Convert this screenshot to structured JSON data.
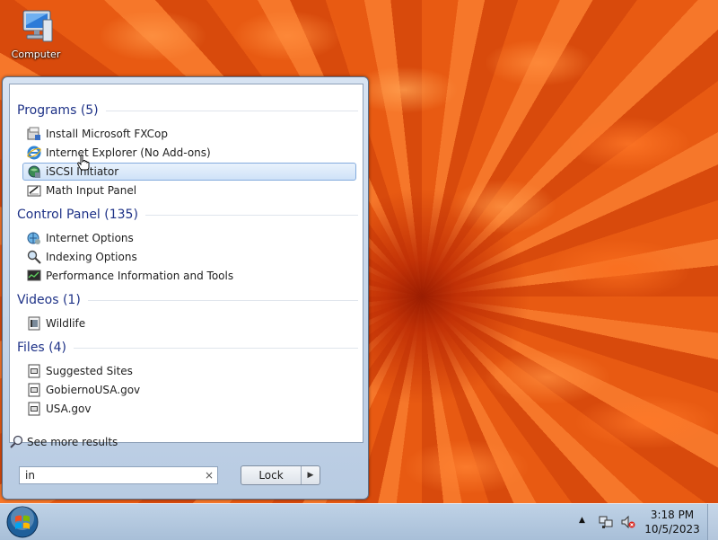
{
  "desktop": {
    "icons": [
      {
        "label": "Computer",
        "icon": "computer-icon"
      }
    ]
  },
  "start_menu": {
    "groups": [
      {
        "title": "Programs (5)",
        "items": [
          {
            "label": "Install Microsoft FXCop",
            "icon": "installer-icon"
          },
          {
            "label": "Internet Explorer (No Add-ons)",
            "icon": "ie-icon"
          },
          {
            "label": "iSCSI Initiator",
            "icon": "iscsi-icon",
            "selected": true
          },
          {
            "label": "Math Input Panel",
            "icon": "math-input-icon"
          }
        ]
      },
      {
        "title": "Control Panel (135)",
        "items": [
          {
            "label": "Internet Options",
            "icon": "internet-options-icon"
          },
          {
            "label": "Indexing Options",
            "icon": "indexing-options-icon"
          },
          {
            "label": "Performance Information and Tools",
            "icon": "performance-icon"
          }
        ]
      },
      {
        "title": "Videos (1)",
        "items": [
          {
            "label": "Wildlife",
            "icon": "video-file-icon"
          }
        ]
      },
      {
        "title": "Files (4)",
        "items": [
          {
            "label": "Suggested Sites",
            "icon": "file-icon"
          },
          {
            "label": "GobiernoUSA.gov",
            "icon": "file-icon"
          },
          {
            "label": "USA.gov",
            "icon": "file-icon"
          }
        ]
      }
    ],
    "see_more": "See more results",
    "search": {
      "value": "in",
      "clear_glyph": "×"
    },
    "power_button": {
      "label": "Lock",
      "arrow": "▶"
    }
  },
  "taskbar": {
    "tray_arrow": "▲",
    "clock": {
      "time": "3:18 PM",
      "date": "10/5/2023"
    }
  },
  "colors": {
    "group_header": "#1e3287",
    "selection_border": "#84acdd",
    "taskbar": "#b4c8de"
  }
}
